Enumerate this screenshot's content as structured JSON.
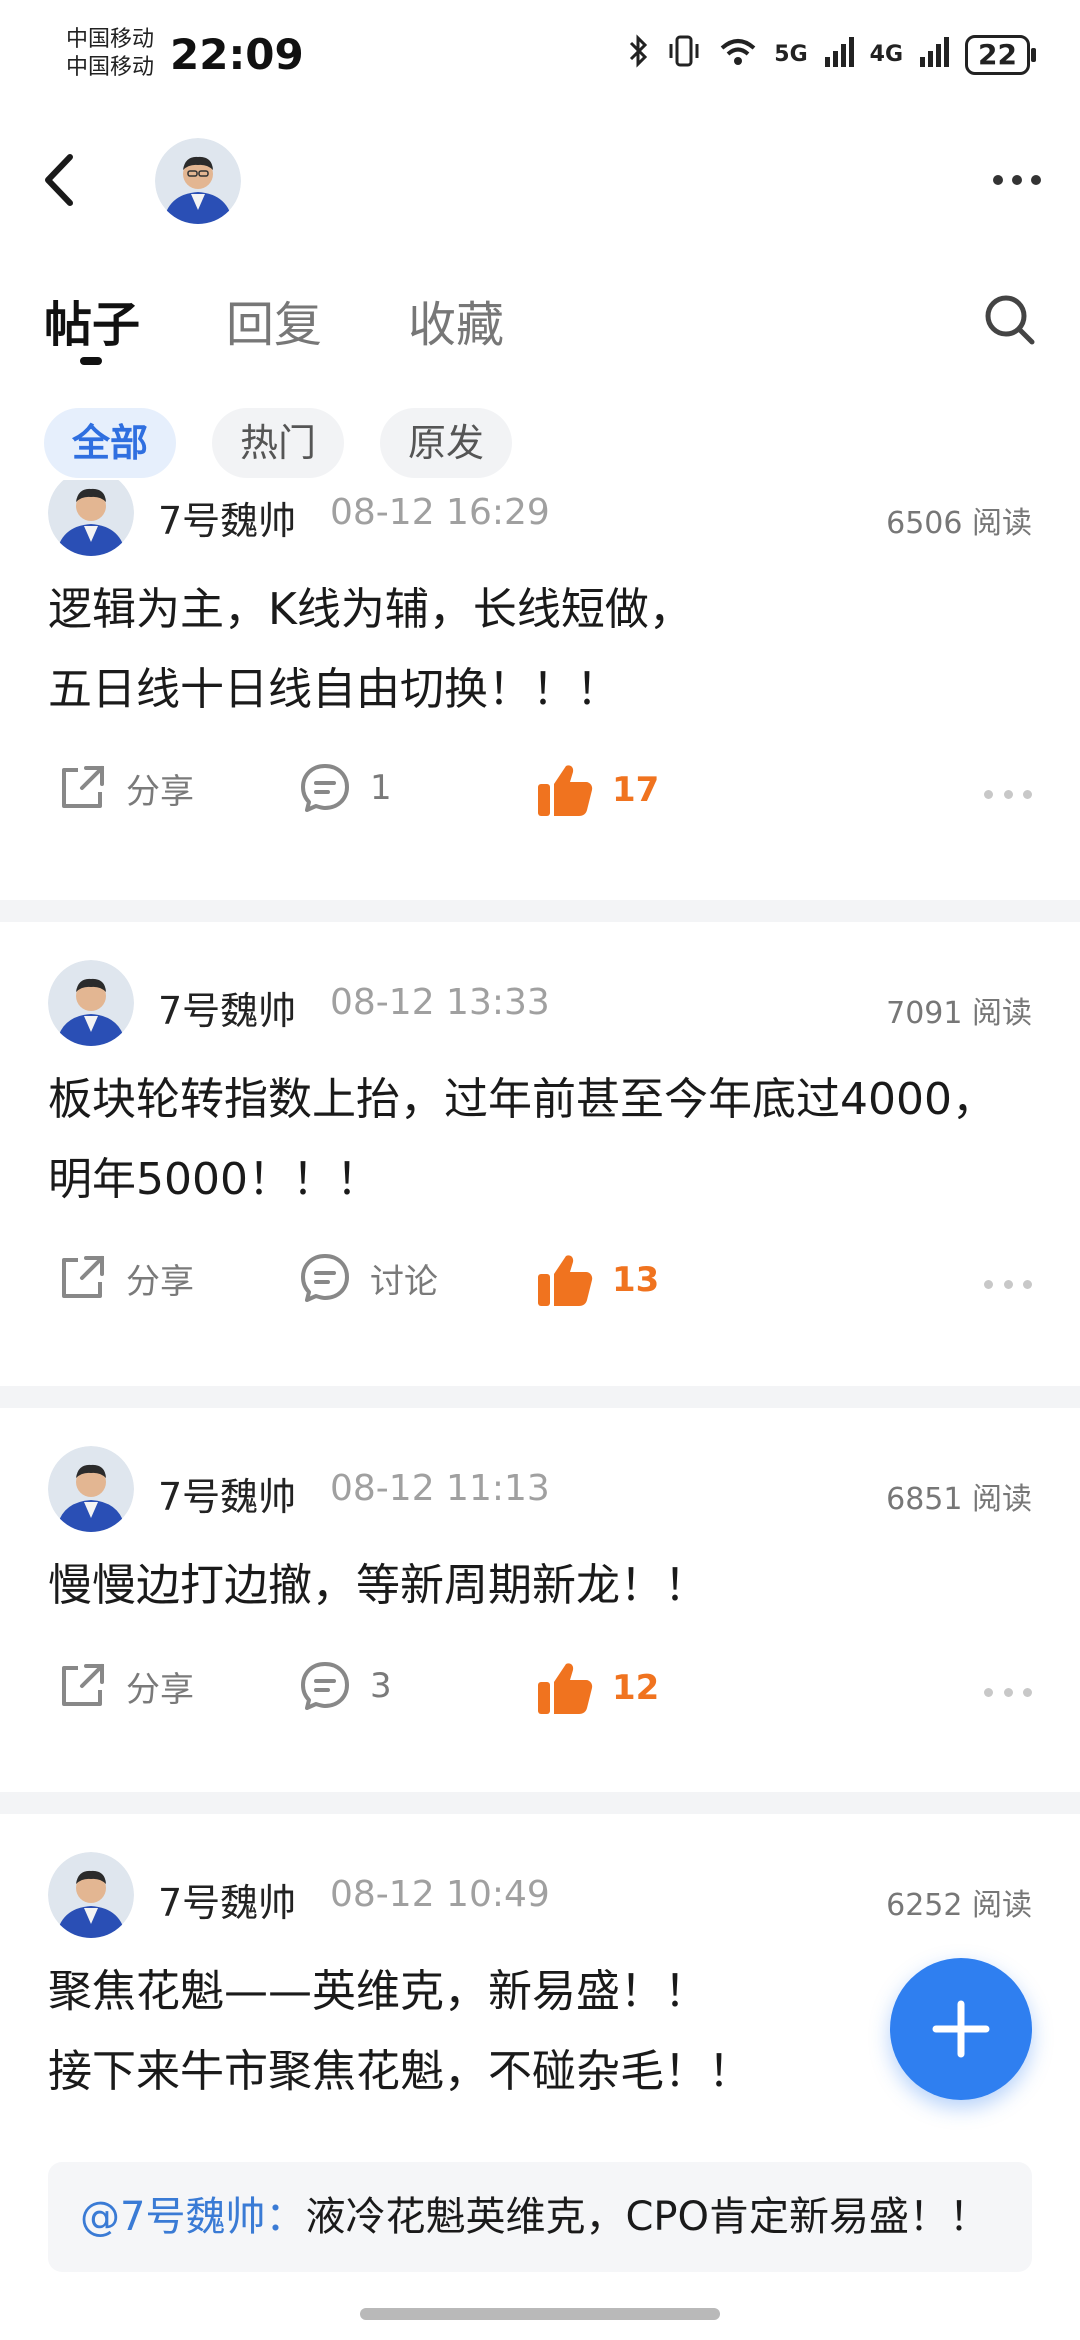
{
  "status_bar": {
    "carrier_1": "中国移动",
    "carrier_2": "中国移动",
    "time": "22:09",
    "signal_1": "5G",
    "signal_2": "4G",
    "battery": "22"
  },
  "tabs": [
    {
      "label": "帖子",
      "active": true
    },
    {
      "label": "回复",
      "active": false
    },
    {
      "label": "收藏",
      "active": false
    }
  ],
  "filters": [
    {
      "label": "全部",
      "active": true
    },
    {
      "label": "热门",
      "active": false
    },
    {
      "label": "原发",
      "active": false
    }
  ],
  "posts": [
    {
      "author": "7号魏帅",
      "time": "08-12 16:29",
      "reads": "6506 阅读",
      "lines": [
        "逻辑为主，K线为辅，长线短做，",
        "五日线十日线自由切换！！！"
      ],
      "share": "分享",
      "comments": "1",
      "likes": "17"
    },
    {
      "author": "7号魏帅",
      "time": "08-12 13:33",
      "reads": "7091 阅读",
      "lines": [
        "板块轮转指数上抬，过年前甚至今年底过4000，",
        "明年5000！！！"
      ],
      "share": "分享",
      "comments": "讨论",
      "likes": "13"
    },
    {
      "author": "7号魏帅",
      "time": "08-12 11:13",
      "reads": "6851 阅读",
      "lines": [
        "慢慢边打边撤，等新周期新龙！！"
      ],
      "share": "分享",
      "comments": "3",
      "likes": "12"
    },
    {
      "author": "7号魏帅",
      "time": "08-12 10:49",
      "reads": "6252 阅读",
      "lines": [
        "聚焦花魁——英维克，新易盛！！",
        "接下来牛市聚焦花魁，不碰杂毛！！"
      ],
      "quote_mention": "@7号魏帅：",
      "quote_text": "液冷花魁英维克，CPO肯定新易盛！！"
    }
  ],
  "colors": {
    "accent": "#2f7ff0",
    "like": "#f0731f",
    "mention": "#3a7bd5"
  }
}
